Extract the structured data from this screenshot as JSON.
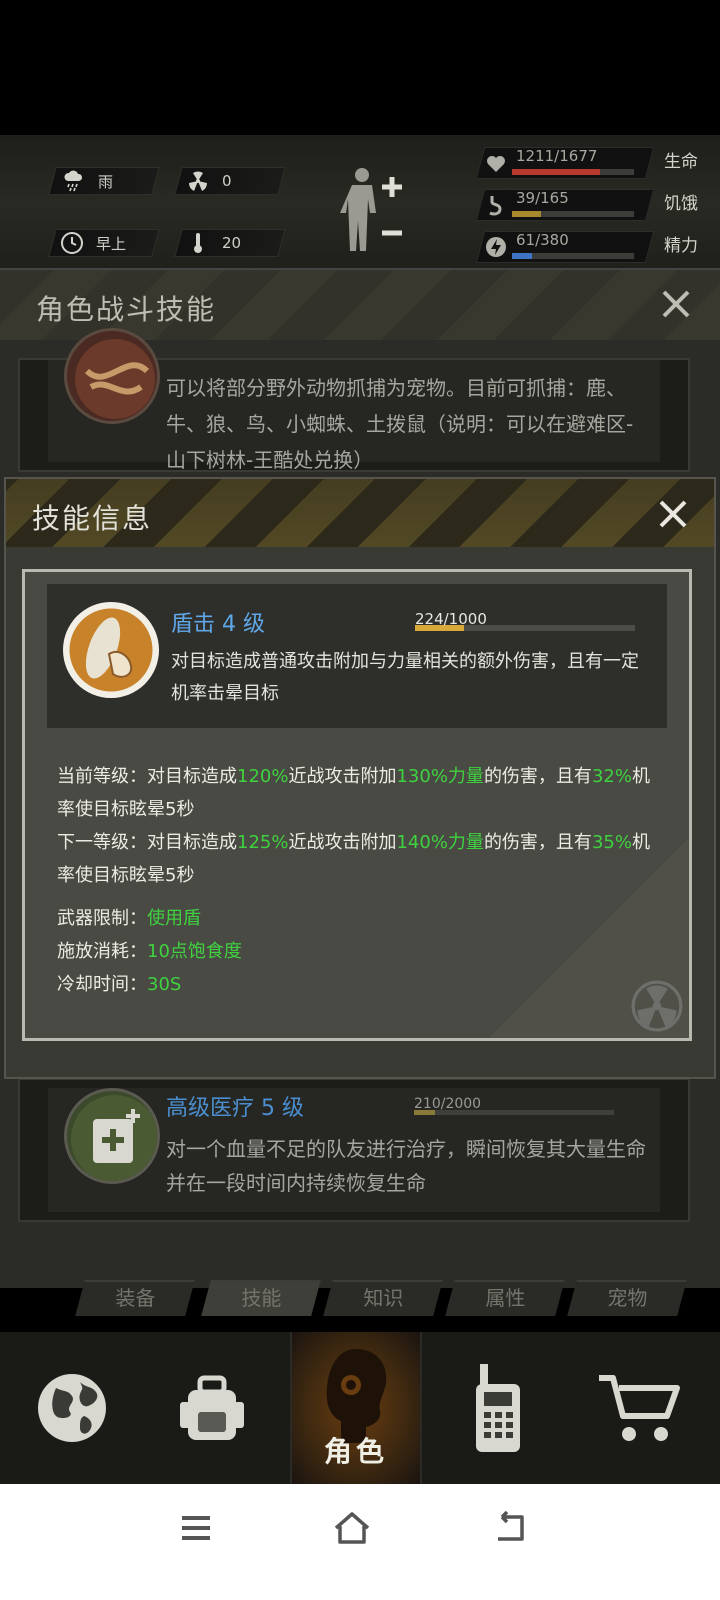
{
  "status": {
    "weather": "雨",
    "radiation": "0",
    "time_of_day": "早上",
    "temperature": "20"
  },
  "vitals": [
    {
      "value": "1211/1677",
      "label": "生命",
      "fraction": 0.722,
      "color": "#b83a2e"
    },
    {
      "value": "39/165",
      "label": "饥饿",
      "fraction": 0.236,
      "color": "#a8892e"
    },
    {
      "value": "61/380",
      "label": "精力",
      "fraction": 0.16,
      "color": "#3e74c4"
    }
  ],
  "background_panel": {
    "title": "角色战斗技能",
    "pet_skill_desc": "可以将部分野外动物抓捕为宠物。目前可抓捕：鹿、牛、狼、鸟、小蜘蛛、土拨鼠（说明：可以在避难区-山下树林-王酷处兑换）",
    "heal_skill": {
      "name": "高级医疗 5 级",
      "exp": "210/2000",
      "exp_fraction": 0.105,
      "desc": "对一个血量不足的队友进行治疗，瞬间恢复其大量生命并在一段时间内持续恢复生命"
    }
  },
  "dialog": {
    "title": "技能信息",
    "skill_name": "盾击 4 级",
    "exp": "224/1000",
    "exp_fraction": 0.224,
    "skill_desc": "对目标造成普通攻击附加与力量相关的额外伤害，且有一定机率击晕目标",
    "current_level": {
      "p1": "当前等级：对目标造成",
      "v1": "120%",
      "p2": "近战攻击附加",
      "v2": "130%力量",
      "p3": "的伤害，且有",
      "v3": "32%",
      "p4": "机率使目标眩晕5秒"
    },
    "next_level": {
      "p1": "下一等级：对目标造成",
      "v1": "125%",
      "p2": "近战攻击附加",
      "v2": "140%力量",
      "p3": "的伤害，且有",
      "v3": "35%",
      "p4": "机率使目标眩晕5秒"
    },
    "weapon_label": "武器限制：",
    "weapon_value": "使用盾",
    "cost_label": "施放消耗：",
    "cost_value": "10点饱食度",
    "cooldown_label": "冷却时间：",
    "cooldown_value": "30S"
  },
  "tabs": [
    "装备",
    "技能",
    "知识",
    "属性",
    "宠物"
  ],
  "bottom_nav": {
    "active_label": "角色",
    "items": [
      "globe-icon",
      "backpack-icon",
      "character-icon",
      "radio-icon",
      "cart-icon"
    ]
  }
}
